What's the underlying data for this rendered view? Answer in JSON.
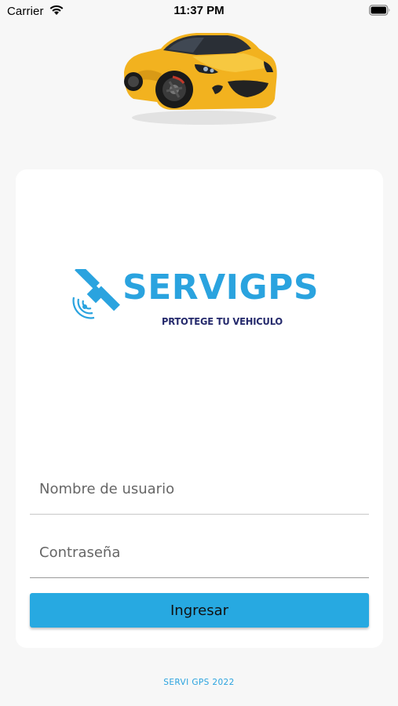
{
  "status_bar": {
    "carrier": "Carrier",
    "time": "11:37 PM",
    "icons": [
      "wifi-icon",
      "battery-icon"
    ]
  },
  "hero": {
    "image": "yellow-sports-car"
  },
  "logo": {
    "title": "SERVIGPS",
    "tagline": "PRTOTEGE TU VEHICULO",
    "icon": "satellite-icon",
    "colors": {
      "primary": "#2aa3df",
      "secondary": "#252a6c"
    }
  },
  "form": {
    "username": {
      "placeholder": "Nombre de usuario",
      "value": ""
    },
    "password": {
      "placeholder": "Contraseña",
      "value": ""
    },
    "submit_label": "Ingresar"
  },
  "footer": {
    "text": "SERVI GPS 2022"
  },
  "colors": {
    "background": "#f7f7f7",
    "card": "#ffffff",
    "button": "#27a9e1",
    "accent": "#2aa3df"
  }
}
